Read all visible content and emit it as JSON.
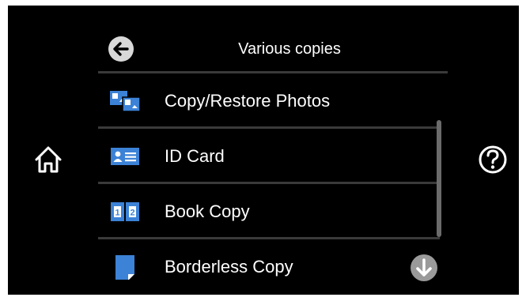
{
  "header": {
    "title": "Various copies",
    "back_icon": "arrow-left-icon"
  },
  "sidebar_left": {
    "home_icon": "home-icon"
  },
  "sidebar_right": {
    "help_icon": "question-mark-icon"
  },
  "menu": {
    "items": [
      {
        "label": "Copy/Restore Photos",
        "icon": "photos-icon"
      },
      {
        "label": "ID Card",
        "icon": "id-card-icon"
      },
      {
        "label": "Book Copy",
        "icon": "book-icon"
      },
      {
        "label": "Borderless Copy",
        "icon": "document-icon"
      }
    ]
  },
  "scroll": {
    "down_icon": "arrow-down-icon"
  },
  "colors": {
    "background": "#000000",
    "accent": "#3c82d6",
    "divider": "#3a3a3a",
    "disabled": "#9a9a9a"
  }
}
